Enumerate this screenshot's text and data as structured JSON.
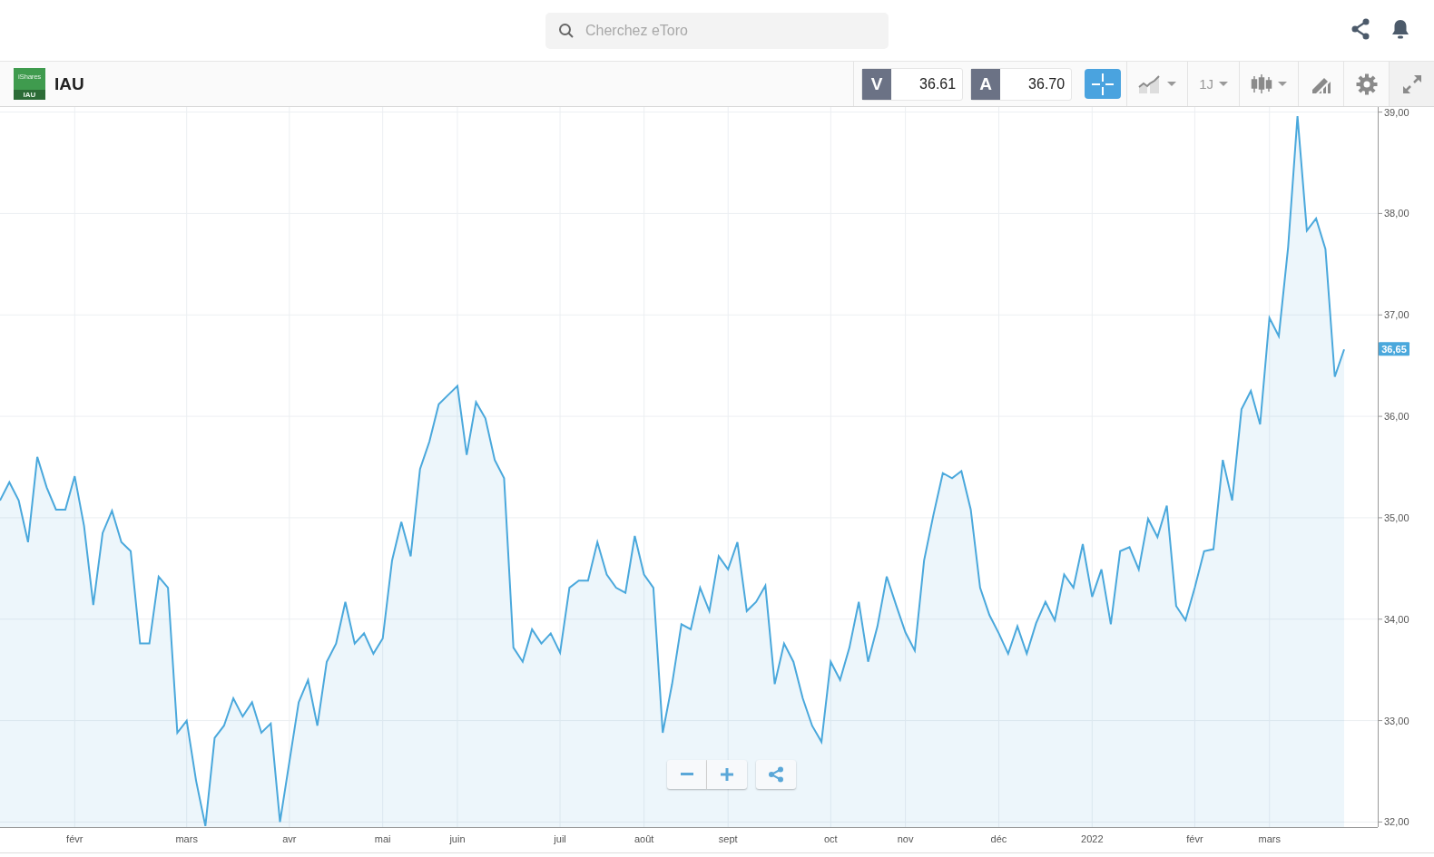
{
  "header": {
    "search": {
      "placeholder": "Cherchez eToro"
    }
  },
  "instrument": {
    "logo": {
      "brand": "iShares",
      "ticker": "IAU"
    },
    "symbol": "IAU",
    "prices": [
      {
        "label": "V",
        "value": "36.61"
      },
      {
        "label": "A",
        "value": "36.70"
      }
    ],
    "tools": [
      {
        "kind": "crosshair",
        "selected": true
      },
      {
        "kind": "chart-type",
        "selected": false
      },
      {
        "kind": "timeframe",
        "label": "1J",
        "selected": false
      },
      {
        "kind": "candles",
        "selected": false
      },
      {
        "kind": "draw",
        "selected": false
      },
      {
        "kind": "settings",
        "selected": false
      },
      {
        "kind": "fullscreen",
        "selected": false
      }
    ]
  },
  "chart": {
    "zoom_controls": [
      {
        "kind": "zoom-out"
      },
      {
        "kind": "zoom-in"
      },
      {
        "kind": "share"
      }
    ],
    "last_price_tag": {
      "label": "36,65"
    },
    "chart_data": {
      "type": "area",
      "grid": true,
      "ylim": [
        31.95,
        39.05
      ],
      "yticks": [
        {
          "value": 32,
          "label": "32,00"
        },
        {
          "value": 33,
          "label": "33,00"
        },
        {
          "value": 34,
          "label": "34,00"
        },
        {
          "value": 35,
          "label": "35,00"
        },
        {
          "value": 36,
          "label": "36,00"
        },
        {
          "value": 37,
          "label": "37,00"
        },
        {
          "value": 38,
          "label": "38,00"
        },
        {
          "value": 39,
          "label": "39,00"
        }
      ],
      "categories": [
        null,
        null,
        null,
        null,
        null,
        null,
        null,
        null,
        "févr",
        null,
        null,
        null,
        null,
        null,
        null,
        null,
        null,
        null,
        null,
        null,
        "mars",
        null,
        null,
        null,
        null,
        null,
        null,
        null,
        null,
        null,
        null,
        "avr",
        null,
        null,
        null,
        null,
        null,
        null,
        null,
        null,
        null,
        "mai",
        null,
        null,
        null,
        null,
        null,
        null,
        null,
        "juin",
        null,
        null,
        null,
        null,
        null,
        null,
        null,
        null,
        null,
        null,
        "juil",
        null,
        null,
        null,
        null,
        null,
        null,
        null,
        null,
        "août",
        null,
        null,
        null,
        null,
        null,
        null,
        null,
        null,
        "sept",
        null,
        null,
        null,
        null,
        null,
        null,
        null,
        null,
        null,
        null,
        "oct",
        null,
        null,
        null,
        null,
        null,
        null,
        null,
        "nov",
        null,
        null,
        null,
        null,
        null,
        null,
        null,
        null,
        null,
        "déc",
        null,
        null,
        null,
        null,
        null,
        null,
        null,
        null,
        null,
        "2022",
        null,
        null,
        null,
        null,
        null,
        null,
        null,
        null,
        null,
        null,
        "févr",
        null,
        null,
        null,
        null,
        null,
        null,
        null,
        "mars",
        null,
        null,
        null,
        null,
        null,
        null,
        null,
        null
      ],
      "series": [
        {
          "color": "#4aa8dc",
          "values": [
            35.17,
            35.35,
            35.17,
            34.76,
            35.6,
            35.3,
            35.08,
            35.08,
            35.41,
            34.92,
            34.14,
            34.85,
            35.07,
            34.76,
            34.67,
            33.76,
            33.76,
            34.42,
            34.31,
            32.88,
            33.0,
            32.41,
            31.96,
            32.83,
            32.95,
            33.22,
            33.04,
            33.18,
            32.88,
            32.97,
            32.0,
            32.59,
            33.18,
            33.4,
            32.95,
            33.58,
            33.76,
            34.17,
            33.76,
            33.86,
            33.66,
            33.81,
            34.58,
            34.96,
            34.62,
            35.48,
            35.75,
            36.12,
            36.21,
            36.3,
            35.62,
            36.14,
            35.98,
            35.57,
            35.39,
            33.72,
            33.58,
            33.9,
            33.76,
            33.86,
            33.67,
            34.31,
            34.38,
            34.38,
            34.76,
            34.44,
            34.31,
            34.26,
            34.82,
            34.44,
            34.31,
            32.88,
            33.36,
            33.95,
            33.9,
            34.31,
            34.08,
            34.62,
            34.49,
            34.76,
            34.08,
            34.17,
            34.33,
            33.36,
            33.76,
            33.58,
            33.22,
            32.95,
            32.79,
            33.58,
            33.4,
            33.72,
            34.17,
            33.58,
            33.93,
            34.42,
            34.14,
            33.87,
            33.69,
            34.58,
            35.03,
            35.44,
            35.39,
            35.46,
            35.08,
            34.31,
            34.04,
            33.86,
            33.66,
            33.93,
            33.66,
            33.96,
            34.17,
            33.99,
            34.44,
            34.31,
            34.74,
            34.22,
            34.49,
            33.95,
            34.67,
            34.71,
            34.49,
            34.99,
            34.81,
            35.12,
            34.13,
            33.99,
            34.31,
            34.67,
            34.69,
            35.57,
            35.17,
            36.07,
            36.25,
            35.92,
            36.97,
            36.79,
            37.67,
            38.96,
            37.83,
            37.95,
            37.65,
            36.39,
            36.66
          ]
        }
      ]
    }
  }
}
